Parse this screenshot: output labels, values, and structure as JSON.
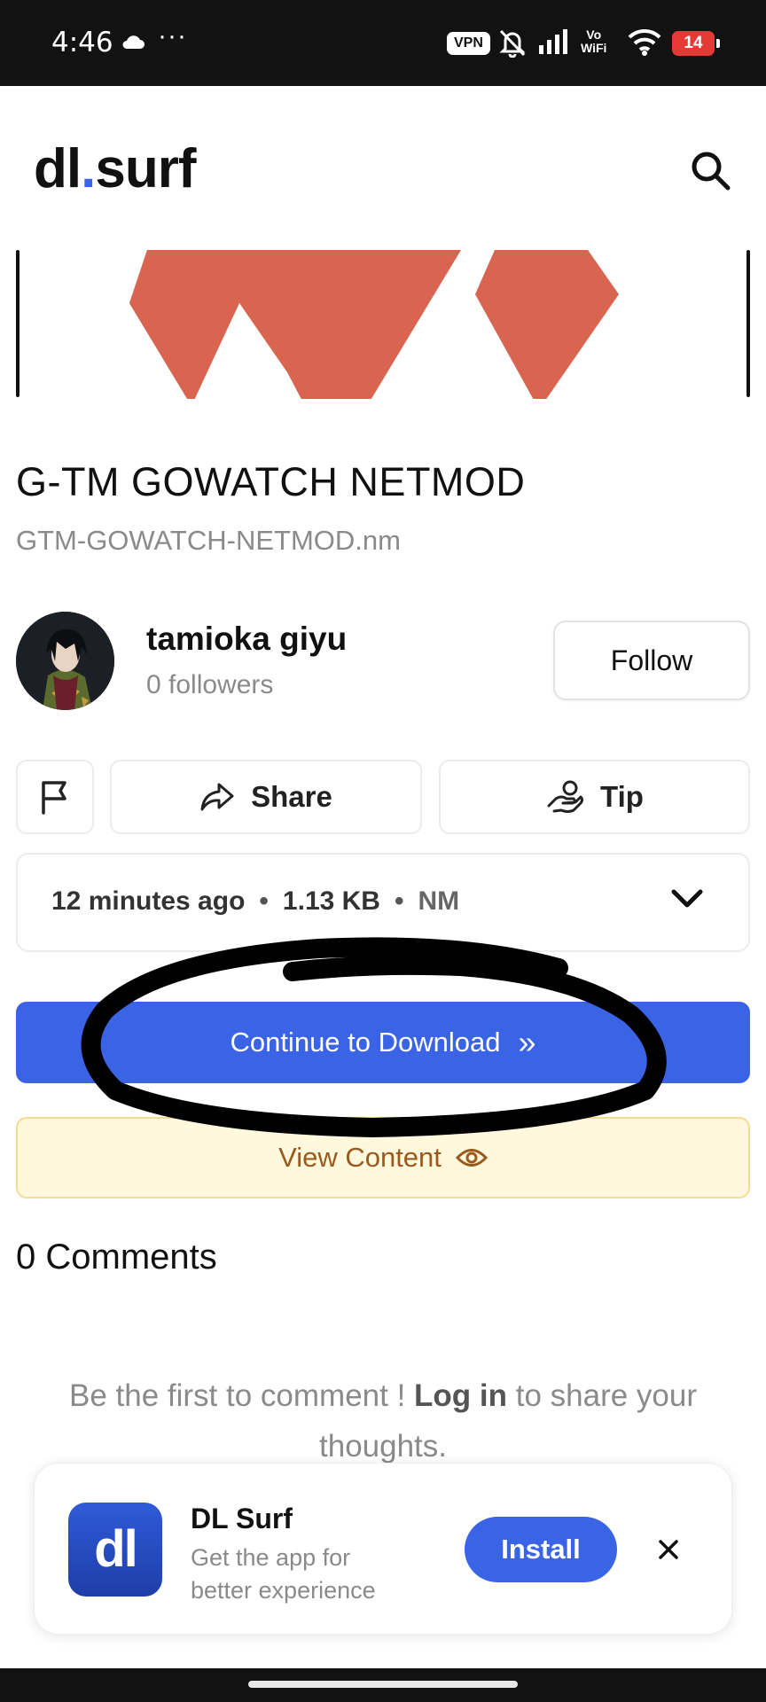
{
  "status_bar": {
    "time": "4:46",
    "overflow_dots": "···",
    "vpn": "VPN",
    "vowifi_top": "Vo",
    "vowifi_bottom": "WiFi",
    "battery": "14"
  },
  "header": {
    "logo_left": "dl",
    "logo_dot": ".",
    "logo_right": "surf"
  },
  "file": {
    "title": "G-TM GOWATCH NETMOD",
    "filename": "GTM-GOWATCH-NETMOD.nm",
    "uploaded": "12 minutes ago",
    "size": "1.13 KB",
    "extension": "NM"
  },
  "author": {
    "name": "tamioka giyu",
    "followers": "0 followers",
    "follow_label": "Follow"
  },
  "actions": {
    "share_label": "Share",
    "tip_label": "Tip"
  },
  "meta_separator": "•",
  "download": {
    "label": "Continue to Download",
    "icon": "»"
  },
  "view_content": {
    "label": "View Content"
  },
  "comments": {
    "title": "0 Comments",
    "empty_prefix": "Be the first to comment ! ",
    "login_label": "Log in",
    "empty_suffix": " to share your thoughts."
  },
  "install_banner": {
    "app_icon_text": "dl",
    "app_name": "DL Surf",
    "description": "Get the app for better experience",
    "install_label": "Install"
  },
  "colors": {
    "accent": "#3b63e6",
    "preview_red": "#d9644f",
    "view_bg": "#fff8dc",
    "view_text": "#9a5a1e",
    "battery": "#e53935"
  }
}
